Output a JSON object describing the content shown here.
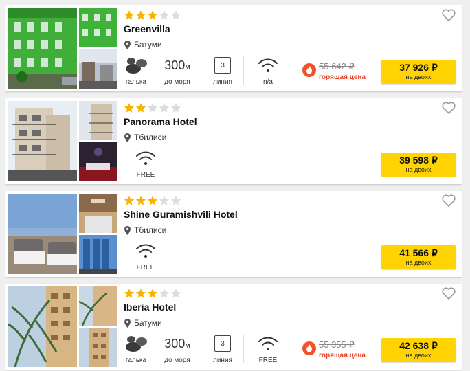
{
  "colors": {
    "accent": "#ffd402",
    "star_on": "#f4b400",
    "star_off": "#dcdcdc",
    "hot": "#e8432b"
  },
  "hotels": [
    {
      "name": "Greenvilla",
      "stars": 3,
      "location": "Батуми",
      "features": {
        "beach_label": "галька",
        "distance_value": "300",
        "distance_unit": "м",
        "distance_label": "до моря",
        "line_value": "3",
        "line_label": "линия",
        "wifi_label": "n/a"
      },
      "old_price": "55 642 ₽",
      "hot_label": "горящая цена",
      "price": "37 926 ₽",
      "price_note": "на двоих"
    },
    {
      "name": "Panorama Hotel",
      "stars": 2,
      "location": "Тбилиси",
      "features": {
        "wifi_label": "FREE"
      },
      "price": "39 598 ₽",
      "price_note": "на двоих"
    },
    {
      "name": "Shine Guramishvili Hotel",
      "stars": 3,
      "location": "Тбилиси",
      "features": {
        "wifi_label": "FREE"
      },
      "price": "41 566 ₽",
      "price_note": "на двоих"
    },
    {
      "name": "Iberia Hotel",
      "stars": 3,
      "location": "Батуми",
      "features": {
        "beach_label": "галька",
        "distance_value": "300",
        "distance_unit": "м",
        "distance_label": "до моря",
        "line_value": "3",
        "line_label": "линия",
        "wifi_label": "FREE"
      },
      "old_price": "55 355 ₽",
      "hot_label": "горящая цена",
      "price": "42 638 ₽",
      "price_note": "на двоих"
    }
  ]
}
